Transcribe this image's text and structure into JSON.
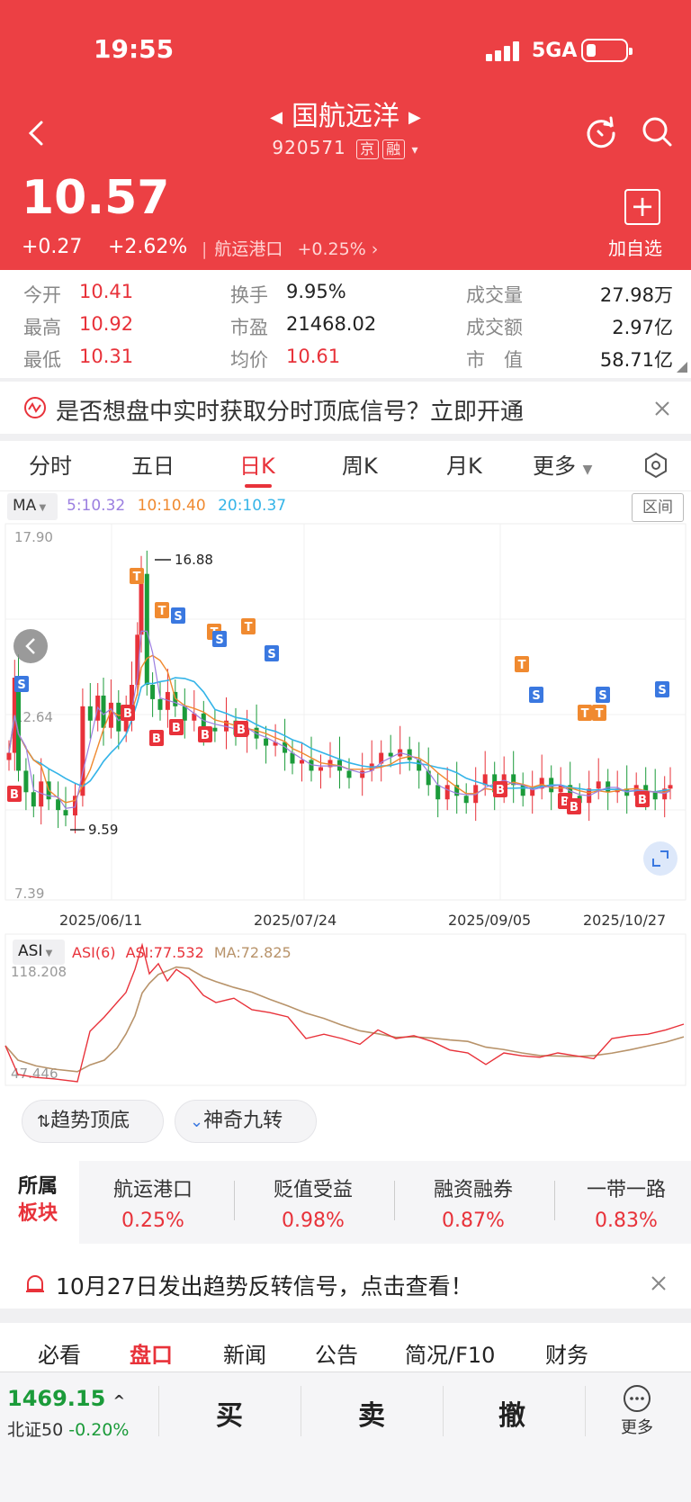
{
  "status_bar": {
    "time": "19:55",
    "network": "5GA"
  },
  "header": {
    "stock_name": "国航远洋",
    "stock_code": "920571",
    "tags": [
      "京",
      "融"
    ],
    "price": "10.57",
    "change": "+0.27",
    "change_pct": "+2.62%",
    "sector_name": "航运港口",
    "sector_change": "+0.25%",
    "add_favorite_label": "加自选"
  },
  "stats": [
    {
      "label": "今开",
      "value": "10.41"
    },
    {
      "label": "最高",
      "value": "10.92"
    },
    {
      "label": "最低",
      "value": "10.31"
    },
    {
      "label": "换手",
      "value": "9.95%"
    },
    {
      "label": "市盈",
      "value": "21468.02"
    },
    {
      "label": "均价",
      "value": "10.61"
    },
    {
      "label": "成交量",
      "value": "27.98万"
    },
    {
      "label": "成交额",
      "value": "2.97亿"
    },
    {
      "label": "市　值",
      "value": "58.71亿"
    }
  ],
  "promo_banner": {
    "text": "是否想盘中实时获取分时顶底信号？立即开通"
  },
  "chart_tabs": [
    "分时",
    "五日",
    "日K",
    "周K",
    "月K",
    "更多"
  ],
  "chart_tab_active": "日K",
  "ma_legend": {
    "button": "MA",
    "ma5": "5:10.32",
    "ma10": "10:10.40",
    "ma20": "20:10.37"
  },
  "range_button": "区间",
  "indicator_legend": {
    "button": "ASI",
    "asi_period": "ASI(6)",
    "asi": "ASI:77.532",
    "ma": "MA:72.825"
  },
  "chart_data": {
    "type": "candlestick",
    "price_axis": {
      "top_label": "17.90",
      "mid_label": "12.64",
      "bottom_label": "7.39",
      "range": [
        7.39,
        17.9
      ]
    },
    "high_marker": "16.88",
    "low_marker": "9.59",
    "x_labels": [
      "2025/06/11",
      "2025/07/24",
      "2025/09/05",
      "2025/10/27"
    ],
    "asi_axis": {
      "top_label": "118.208",
      "bottom_label": "47.446",
      "range": [
        47.446,
        118.208
      ]
    },
    "colors": {
      "up": "#e8323a",
      "down": "#1b9b3a",
      "ma5": "#9b7fe0",
      "ma10": "#f08a30",
      "ma20": "#34b4e8",
      "asi": "#e8323a",
      "asi_ma": "#b8936a"
    }
  },
  "feature_pills": [
    "趋势顶底",
    "神奇九转"
  ],
  "sectors": {
    "head": [
      "所属",
      "板块"
    ],
    "items": [
      {
        "name": "航运港口",
        "pct": "0.25%"
      },
      {
        "name": "贬值受益",
        "pct": "0.98%"
      },
      {
        "name": "融资融券",
        "pct": "0.87%"
      },
      {
        "name": "一带一路",
        "pct": "0.83%"
      }
    ]
  },
  "alert_banner": {
    "text": "10月27日发出趋势反转信号，点击查看！"
  },
  "bottom_tabs": [
    "必看",
    "盘口",
    "新闻",
    "公告",
    "简况/F10",
    "财务"
  ],
  "bottom_tab_active": "盘口",
  "bottom_bar": {
    "index_value": "1469.15",
    "index_name": "北证50",
    "index_change": "-0.20%",
    "buttons": [
      "买",
      "卖",
      "撤"
    ],
    "more_label": "更多"
  }
}
